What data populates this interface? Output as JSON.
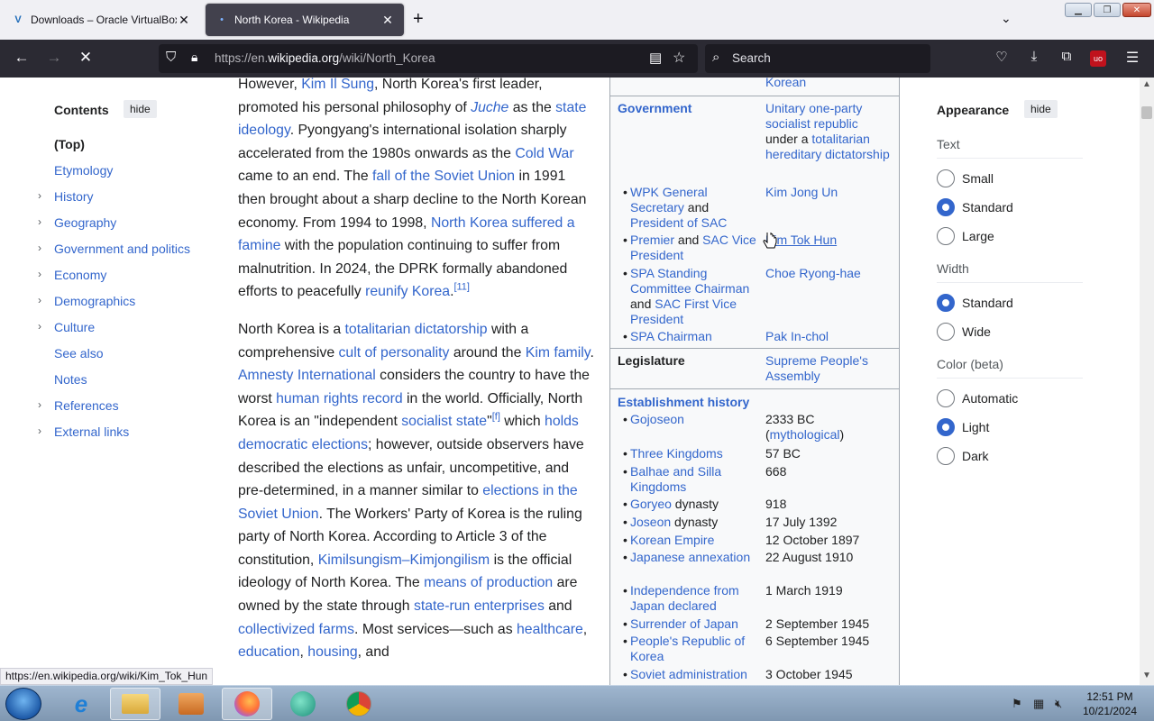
{
  "browser": {
    "tabs": [
      {
        "title": "Downloads – Oracle VirtualBox",
        "active": false
      },
      {
        "title": "North Korea - Wikipedia",
        "active": true
      }
    ],
    "url_prefix": "https://en.",
    "url_domain": "wikipedia.org",
    "url_path": "/wiki/North_Korea",
    "search_placeholder": "Search",
    "status_url": "https://en.wikipedia.org/wiki/Kim_Tok_Hun"
  },
  "toc": {
    "title": "Contents",
    "hide": "hide",
    "items": [
      "(Top)",
      "Etymology",
      "History",
      "Geography",
      "Government and politics",
      "Economy",
      "Demographics",
      "Culture",
      "See also",
      "Notes",
      "References",
      "External links"
    ]
  },
  "article": {
    "p0_pre": "However, ",
    "p0_l1": "Kim Il Sung",
    "p0_t1": ", North Korea's first leader, promoted his personal philosophy of ",
    "p0_l2": "Juche",
    "p0_t2": " as the ",
    "p0_l3": "state ideology",
    "p0_t3": ". Pyongyang's international isolation sharply accelerated from the 1980s onwards as the ",
    "p0_l4": "Cold War",
    "p0_t4": " came to an end. The ",
    "p0_l5": "fall of the Soviet Union",
    "p0_t5": " in 1991 then brought about a sharp decline to the North Korean economy. From 1994 to 1998, ",
    "p0_l6": "North Korea suffered a famine",
    "p0_t6": " with the population continuing to suffer from malnutrition. In 2024, the DPRK formally abandoned efforts to peacefully ",
    "p0_l7": "reunify Korea",
    "p0_t7": ".",
    "p0_ref": "[11]",
    "p1_t0": "North Korea is a ",
    "p1_l1": "totalitarian dictatorship",
    "p1_t1": " with a comprehensive ",
    "p1_l2": "cult of personality",
    "p1_t2": " around the ",
    "p1_l3": "Kim family",
    "p1_t3": ". ",
    "p1_l4": "Amnesty International",
    "p1_t4": " considers the country to have the worst ",
    "p1_l5": "human rights record",
    "p1_t5": " in the world. Officially, North Korea is an \"independent ",
    "p1_l6": "socialist state",
    "p1_t6": "\"",
    "p1_ref": "[f]",
    "p1_t7": " which ",
    "p1_l7": "holds democratic elections",
    "p1_t8": "; however, outside observers have described the elections as unfair, uncompetitive, and pre-determined, in a manner similar to ",
    "p1_l8": "elections in the Soviet Union",
    "p1_t9": ". The Workers' Party of Korea is the ruling party of North Korea. According to Article 3 of the constitution, ",
    "p1_l9": "Kimilsungism–Kimjongilism",
    "p1_t10": " is the official ideology of North Korea. The ",
    "p1_l10": "means of production",
    "p1_t11": " are owned by the state through ",
    "p1_l11": "state-run enterprises",
    "p1_t12": " and ",
    "p1_l12": "collectivized farms",
    "p1_t13": ". Most services—such as ",
    "p1_l13": "healthcare",
    "p1_t14": ", ",
    "p1_l14": "education",
    "p1_t15": ", ",
    "p1_l15": "housing",
    "p1_t16": ", and"
  },
  "infobox": {
    "top_val": "Korean",
    "government_label": "Government",
    "government_v1": "Unitary one-party socialist republic",
    "government_v2": " under a ",
    "government_v3": "totalitarian hereditary dictatorship",
    "r1_l1": "WPK General Secretary",
    "r1_t": " and ",
    "r1_l2": "President of SAC",
    "r1_v": "Kim Jong Un",
    "r2_l1": "Premier",
    "r2_t": " and ",
    "r2_l2": "SAC Vice President",
    "r2_v": "Kim Tok Hun",
    "r3_l1": "SPA Standing Committee Chairman",
    "r3_t": " and ",
    "r3_l2": "SAC First Vice President",
    "r3_v": "Choe Ryong-hae",
    "r4_l1": "SPA Chairman",
    "r4_v": "Pak In-chol",
    "legislature_label": "Legislature",
    "legislature_val": "Supreme People's Assembly",
    "history_label": "Establishment history",
    "history": [
      {
        "name": "Gojoseon",
        "suffix": "",
        "date": "2333 BC",
        "extra": "mythological"
      },
      {
        "name": "Three Kingdoms",
        "suffix": "",
        "date": "57 BC"
      },
      {
        "name": "Balhae and Silla Kingdoms",
        "suffix": "",
        "date": "668"
      },
      {
        "name": "Goryeo",
        "suffix": " dynasty",
        "date": "918"
      },
      {
        "name": "Joseon",
        "suffix": " dynasty",
        "date": "17 July 1392"
      },
      {
        "name": "Korean Empire",
        "suffix": "",
        "date": "12 October 1897"
      },
      {
        "name": "Japanese annexation",
        "suffix": "",
        "date": "22 August 1910"
      },
      {
        "name": "Independence from Japan declared",
        "suffix": "",
        "date": "1 March 1919"
      },
      {
        "name": "Surrender of Japan",
        "suffix": "",
        "date": "2 September 1945"
      },
      {
        "name": "People's Republic of Korea",
        "suffix": "",
        "date": "6 September 1945"
      },
      {
        "name": "Soviet administration",
        "suffix": "",
        "date": "3 October 1945"
      }
    ]
  },
  "appearance": {
    "title": "Appearance",
    "hide": "hide",
    "text_head": "Text",
    "text_opts": [
      "Small",
      "Standard",
      "Large"
    ],
    "width_head": "Width",
    "width_opts": [
      "Standard",
      "Wide"
    ],
    "color_head": "Color (beta)",
    "color_opts": [
      "Automatic",
      "Light",
      "Dark"
    ]
  },
  "taskbar": {
    "time": "12:51 PM",
    "date": "10/21/2024"
  },
  "colors": {
    "link": "#3366cc",
    "radio_selected": "#3366cc",
    "nav_bg": "#2b2a33"
  }
}
